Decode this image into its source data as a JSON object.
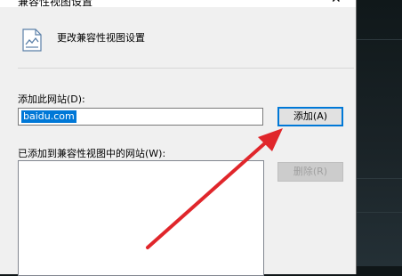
{
  "dialog": {
    "title": "兼容性视图设置",
    "close_glyph": "✕",
    "heading": "更改兼容性视图设置",
    "add_label": "添加此网站(D):",
    "site_input_value": "baidu.com",
    "add_button": "添加(A)",
    "list_label": "已添加到兼容性视图中的网站(W):",
    "remove_button": "删除(R)"
  },
  "icons": [
    "settings-page-icon",
    "close-icon",
    "red-arrow-annotation"
  ],
  "colors": {
    "selection": "#0078d7",
    "annotation_arrow": "#e0262b",
    "dialog_bg": "#f0f0f0"
  }
}
